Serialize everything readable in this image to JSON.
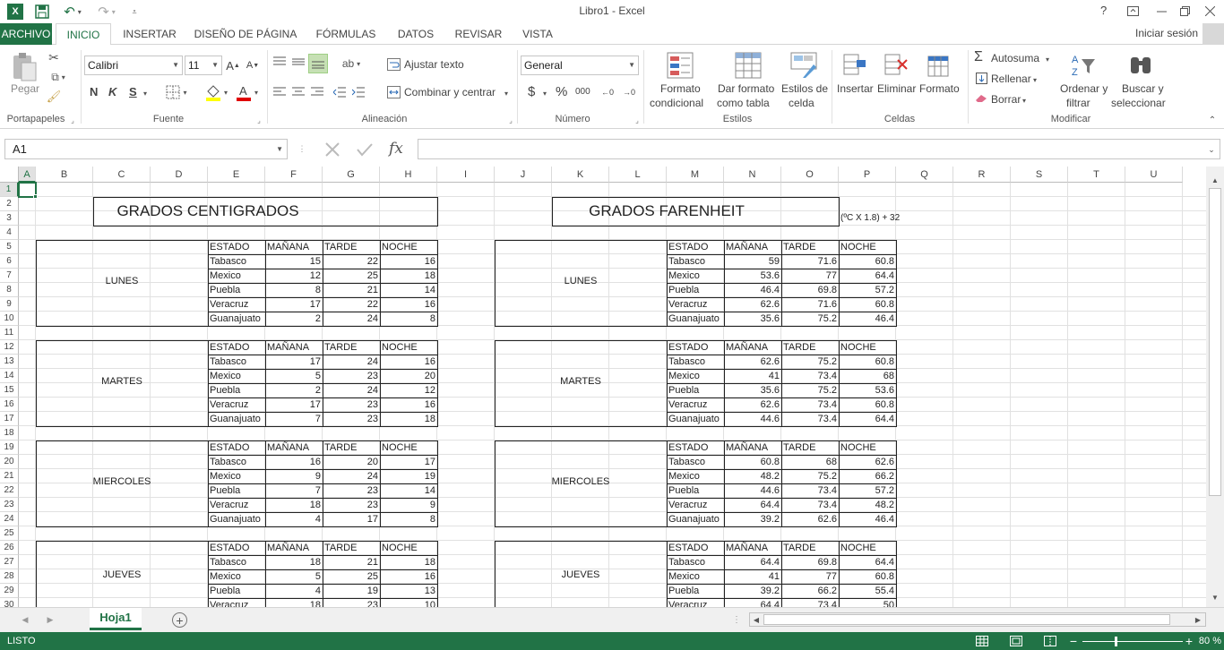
{
  "window": {
    "title": "Libro1 - Excel",
    "help": "?",
    "signin": "Iniciar sesión"
  },
  "tabs": [
    "ARCHIVO",
    "INICIO",
    "INSERTAR",
    "DISEÑO DE PÁGINA",
    "FÓRMULAS",
    "DATOS",
    "REVISAR",
    "VISTA"
  ],
  "ribbon": {
    "clipboard": {
      "paste": "Pegar",
      "label": "Portapapeles"
    },
    "font": {
      "name": "Calibri",
      "size": "11",
      "label": "Fuente",
      "bold": "N",
      "italic": "K",
      "underline": "S"
    },
    "alignment": {
      "wrap": "Ajustar texto",
      "merge": "Combinar y centrar",
      "label": "Alineación"
    },
    "number": {
      "format": "General",
      "label": "Número",
      "currency": "$",
      "percent": "%",
      "thousands": "000"
    },
    "styles": {
      "cond1": "Formato",
      "cond2": "condicional",
      "table1": "Dar formato",
      "table2": "como tabla",
      "cell1": "Estilos de",
      "cell2": "celda",
      "label": "Estilos"
    },
    "cells": {
      "insert": "Insertar",
      "delete": "Eliminar",
      "format": "Formato",
      "label": "Celdas"
    },
    "editing": {
      "autosum": "Autosuma",
      "fill": "Rellenar",
      "clear": "Borrar",
      "sort1": "Ordenar y",
      "sort2": "filtrar",
      "find1": "Buscar y",
      "find2": "seleccionar",
      "label": "Modificar"
    }
  },
  "formula_bar": {
    "name_box": "A1",
    "fx": "fx",
    "value": ""
  },
  "columns": [
    "A",
    "B",
    "C",
    "D",
    "E",
    "F",
    "G",
    "H",
    "I",
    "J",
    "K",
    "L",
    "M",
    "N",
    "O",
    "P",
    "Q",
    "R",
    "S",
    "T",
    "U"
  ],
  "rows": [
    "1",
    "2",
    "3",
    "4",
    "5",
    "6",
    "7",
    "8",
    "9",
    "10",
    "11",
    "12",
    "13",
    "14",
    "15",
    "16",
    "17",
    "18",
    "19",
    "20",
    "21",
    "22",
    "23",
    "24",
    "25",
    "26",
    "27",
    "28",
    "29",
    "30"
  ],
  "sheet": {
    "title_c": "GRADOS CENTIGRADOS",
    "title_f": "GRADOS FARENHEIT",
    "formula_note": "(ºC X 1.8) + 32",
    "headers": [
      "ESTADO",
      "MAÑANA",
      "TARDE",
      "NOCHE"
    ],
    "blocks": [
      {
        "day": "LUNES",
        "c": [
          [
            "Tabasco",
            "15",
            "22",
            "16"
          ],
          [
            "Mexico",
            "12",
            "25",
            "18"
          ],
          [
            "Puebla",
            "8",
            "21",
            "14"
          ],
          [
            "Veracruz",
            "17",
            "22",
            "16"
          ],
          [
            "Guanajuato",
            "2",
            "24",
            "8"
          ]
        ],
        "f": [
          [
            "Tabasco",
            "59",
            "71.6",
            "60.8"
          ],
          [
            "Mexico",
            "53.6",
            "77",
            "64.4"
          ],
          [
            "Puebla",
            "46.4",
            "69.8",
            "57.2"
          ],
          [
            "Veracruz",
            "62.6",
            "71.6",
            "60.8"
          ],
          [
            "Guanajuato",
            "35.6",
            "75.2",
            "46.4"
          ]
        ]
      },
      {
        "day": "MARTES",
        "c": [
          [
            "Tabasco",
            "17",
            "24",
            "16"
          ],
          [
            "Mexico",
            "5",
            "23",
            "20"
          ],
          [
            "Puebla",
            "2",
            "24",
            "12"
          ],
          [
            "Veracruz",
            "17",
            "23",
            "16"
          ],
          [
            "Guanajuato",
            "7",
            "23",
            "18"
          ]
        ],
        "f": [
          [
            "Tabasco",
            "62.6",
            "75.2",
            "60.8"
          ],
          [
            "Mexico",
            "41",
            "73.4",
            "68"
          ],
          [
            "Puebla",
            "35.6",
            "75.2",
            "53.6"
          ],
          [
            "Veracruz",
            "62.6",
            "73.4",
            "60.8"
          ],
          [
            "Guanajuato",
            "44.6",
            "73.4",
            "64.4"
          ]
        ]
      },
      {
        "day": "MIERCOLES",
        "c": [
          [
            "Tabasco",
            "16",
            "20",
            "17"
          ],
          [
            "Mexico",
            "9",
            "24",
            "19"
          ],
          [
            "Puebla",
            "7",
            "23",
            "14"
          ],
          [
            "Veracruz",
            "18",
            "23",
            "9"
          ],
          [
            "Guanajuato",
            "4",
            "17",
            "8"
          ]
        ],
        "f": [
          [
            "Tabasco",
            "60.8",
            "68",
            "62.6"
          ],
          [
            "Mexico",
            "48.2",
            "75.2",
            "66.2"
          ],
          [
            "Puebla",
            "44.6",
            "73.4",
            "57.2"
          ],
          [
            "Veracruz",
            "64.4",
            "73.4",
            "48.2"
          ],
          [
            "Guanajuato",
            "39.2",
            "62.6",
            "46.4"
          ]
        ]
      },
      {
        "day": "JUEVES",
        "c": [
          [
            "Tabasco",
            "18",
            "21",
            "18"
          ],
          [
            "Mexico",
            "5",
            "25",
            "16"
          ],
          [
            "Puebla",
            "4",
            "19",
            "13"
          ],
          [
            "Veracruz",
            "18",
            "23",
            "10"
          ]
        ],
        "f": [
          [
            "Tabasco",
            "64.4",
            "69.8",
            "64.4"
          ],
          [
            "Mexico",
            "41",
            "77",
            "60.8"
          ],
          [
            "Puebla",
            "39.2",
            "66.2",
            "55.4"
          ],
          [
            "Veracruz",
            "64.4",
            "73.4",
            "50"
          ]
        ]
      }
    ]
  },
  "sheet_tab": "Hoja1",
  "status": {
    "ready": "LISTO",
    "zoom": "80 %"
  }
}
